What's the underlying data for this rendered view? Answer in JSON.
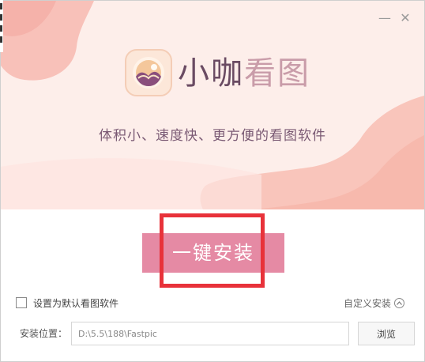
{
  "window": {
    "minimize_glyph": "—",
    "close_glyph": "✕"
  },
  "app": {
    "title_part1": "小咖",
    "title_part2": "看图",
    "tagline": "体积小、速度快、更方便的看图软件",
    "logo_icon": "camera-lens-icon"
  },
  "install": {
    "button_label": "一键安装",
    "default_checkbox_label": "设置为默认看图软件",
    "default_checked": false,
    "custom_install_label": "自定义安装",
    "path_label": "安装位置：",
    "path_value": "D:\\5.5\\188\\Fastpic",
    "browse_label": "浏览"
  },
  "colors": {
    "hero_bg": "#fdeeea",
    "blob": "#f9c3bb",
    "accent": "#e58aa4",
    "highlight": "#e8323a"
  }
}
